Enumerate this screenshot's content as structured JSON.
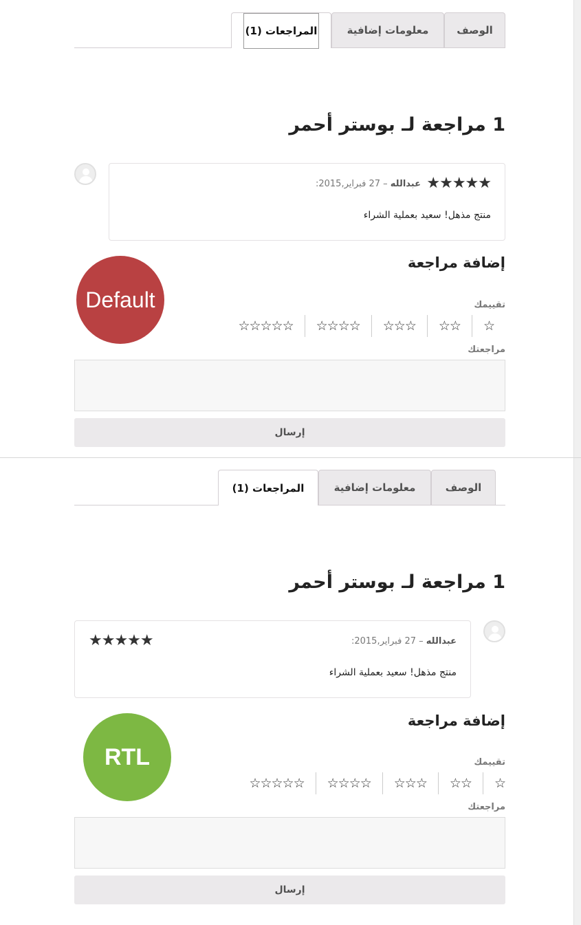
{
  "colors": {
    "default_badge": "#b94142",
    "rtl_badge": "#7db843",
    "tab_bg": "#ebe9eb",
    "button_bg": "#ebe9eb"
  },
  "panels": [
    {
      "tabs": [
        {
          "label": "الوصف"
        },
        {
          "label": "معلومات إضافية"
        },
        {
          "label": "المراجعات (1)"
        }
      ],
      "title": "1 مراجعة لـ بوستر أحمر",
      "review": {
        "stars": "★★★★★",
        "author": "عبدالله",
        "date": "– 27 فبراير,2015:",
        "text": "منتج مذهل! سعيد بعملية الشراء"
      },
      "add_review_title": "إضافة مراجعة",
      "badge": "Default",
      "rating_label": "تقييمك",
      "rating_options": [
        "☆",
        "☆☆",
        "☆☆☆",
        "☆☆☆☆",
        "☆☆☆☆☆"
      ],
      "review_label": "مراجعتك",
      "submit_label": "إرسال"
    },
    {
      "tabs": [
        {
          "label": "الوصف"
        },
        {
          "label": "معلومات إضافية"
        },
        {
          "label": "المراجعات (1)"
        }
      ],
      "title": "1 مراجعة لـ بوستر أحمر",
      "review": {
        "stars": "★★★★★",
        "author": "عبدالله",
        "date": "– 27 فبراير,2015:",
        "text": "منتج مذهل! سعيد بعملية الشراء"
      },
      "add_review_title": "إضافة مراجعة",
      "badge": "RTL",
      "rating_label": "تقييمك",
      "rating_options": [
        "☆",
        "☆☆",
        "☆☆☆",
        "☆☆☆☆",
        "☆☆☆☆☆"
      ],
      "review_label": "مراجعتك",
      "submit_label": "إرسال"
    }
  ]
}
